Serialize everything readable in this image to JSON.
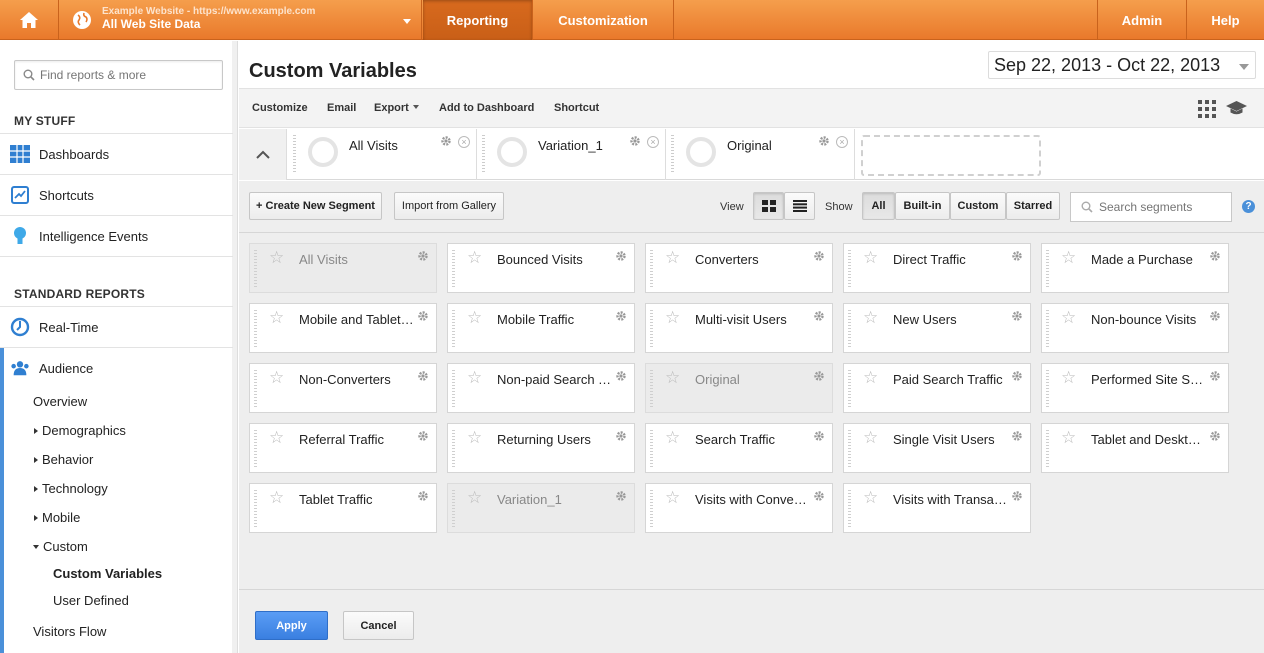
{
  "topbar": {
    "account_line1": "Example Website - https://www.example.com",
    "account_line2": "All Web Site Data",
    "tabs": [
      {
        "label": "Reporting",
        "active": true
      },
      {
        "label": "Customization",
        "active": false
      },
      {
        "label": "Admin",
        "active": false
      },
      {
        "label": "Help",
        "active": false
      }
    ]
  },
  "sidebar": {
    "search_placeholder": "Find reports & more",
    "my_stuff_heading": "MY STUFF",
    "my_stuff": [
      {
        "label": "Dashboards",
        "icon": "dashboards-icon"
      },
      {
        "label": "Shortcuts",
        "icon": "shortcuts-icon"
      },
      {
        "label": "Intelligence Events",
        "icon": "lightbulb-icon"
      }
    ],
    "standard_reports_heading": "STANDARD REPORTS",
    "reports": [
      {
        "label": "Real-Time",
        "icon": "realtime-icon"
      },
      {
        "label": "Audience",
        "icon": "audience-icon"
      }
    ],
    "audience_items": [
      {
        "label": "Overview"
      },
      {
        "label": "Demographics"
      },
      {
        "label": "Behavior"
      },
      {
        "label": "Technology"
      },
      {
        "label": "Mobile"
      },
      {
        "label": "Custom"
      },
      {
        "label": "Custom Variables"
      },
      {
        "label": "User Defined"
      },
      {
        "label": "Visitors Flow"
      }
    ]
  },
  "main": {
    "title": "Custom Variables",
    "date_range": "Sep 22, 2013 - Oct 22, 2013",
    "toolbar": {
      "customize": "Customize",
      "email": "Email",
      "export": "Export",
      "add_to_dashboard": "Add to Dashboard",
      "shortcut": "Shortcut"
    },
    "selected_segments": [
      "All Visits",
      "Variation_1",
      "Original"
    ],
    "picker": {
      "create_new": "+ Create New Segment",
      "import_gallery": "Import from Gallery",
      "view_label": "View",
      "show_label": "Show",
      "filters": [
        "All",
        "Built-in",
        "Custom",
        "Starred"
      ],
      "active_filter": "All",
      "search_placeholder": "Search segments",
      "help": "?"
    },
    "segments": [
      {
        "name": "All Visits",
        "selected": true
      },
      {
        "name": "Bounced Visits",
        "selected": false
      },
      {
        "name": "Converters",
        "selected": false
      },
      {
        "name": "Direct Traffic",
        "selected": false
      },
      {
        "name": "Made a Purchase",
        "selected": false
      },
      {
        "name": "Mobile and Tablet Traffic",
        "selected": false
      },
      {
        "name": "Mobile Traffic",
        "selected": false
      },
      {
        "name": "Multi-visit Users",
        "selected": false
      },
      {
        "name": "New Users",
        "selected": false
      },
      {
        "name": "Non-bounce Visits",
        "selected": false
      },
      {
        "name": "Non-Converters",
        "selected": false
      },
      {
        "name": "Non-paid Search Traffic",
        "selected": false
      },
      {
        "name": "Original",
        "selected": true
      },
      {
        "name": "Paid Search Traffic",
        "selected": false
      },
      {
        "name": "Performed Site Search",
        "selected": false
      },
      {
        "name": "Referral Traffic",
        "selected": false
      },
      {
        "name": "Returning Users",
        "selected": false
      },
      {
        "name": "Search Traffic",
        "selected": false
      },
      {
        "name": "Single Visit Users",
        "selected": false
      },
      {
        "name": "Tablet and Desktop Traffic",
        "selected": false
      },
      {
        "name": "Tablet Traffic",
        "selected": false
      },
      {
        "name": "Variation_1",
        "selected": true
      },
      {
        "name": "Visits with Conversions",
        "selected": false
      },
      {
        "name": "Visits with Transactions",
        "selected": false
      }
    ],
    "apply": "Apply",
    "cancel": "Cancel"
  },
  "colors": {
    "brand": "#e9792b",
    "accent_blue": "#3a7fe0"
  }
}
